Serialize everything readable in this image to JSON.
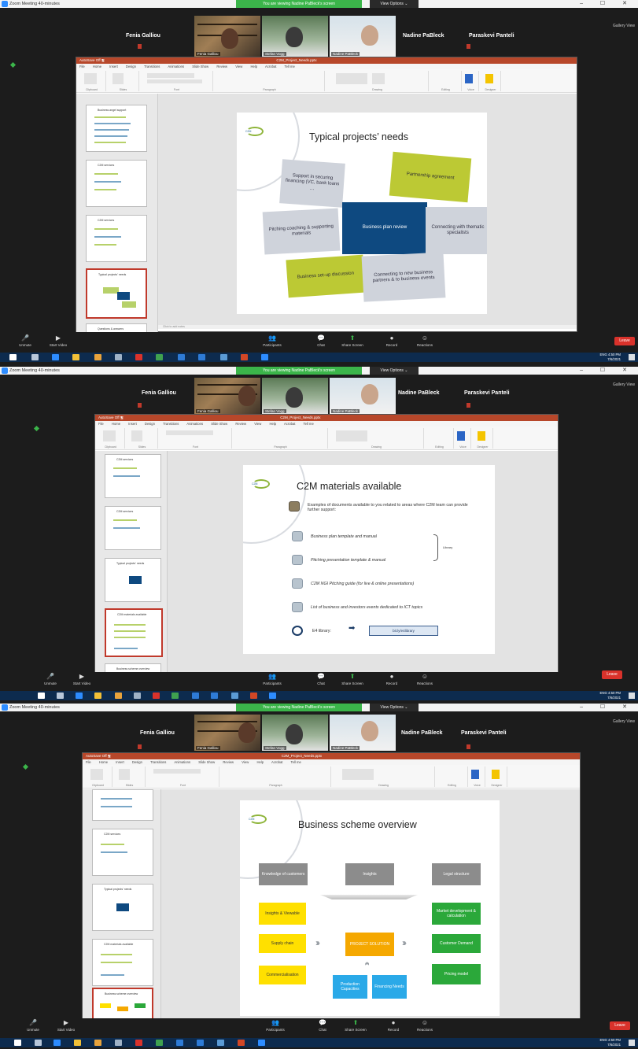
{
  "window": {
    "title": "Zoom Meeting 40-minutes",
    "banner": "You are viewing Nadine PaBleck's screen",
    "view_options": "View Options ⌄",
    "controls": "– ☐ ✕"
  },
  "participants": {
    "left_name": "Fenia Galliou",
    "right_name_1": "Nadine PaBleck",
    "right_name_2": "Paraskevi Panteli",
    "video1_label": "Fenia Galliou",
    "video2_label": "Stefan Vogg",
    "video3_label": "Nadine PaBleck",
    "gallery": "Gallery View"
  },
  "powerpoint": {
    "app": "AutoSave  Off  🖫",
    "doc_title": "C2M_Project_Needs.pptx",
    "tabs": [
      "File",
      "Home",
      "Insert",
      "Design",
      "Transitions",
      "Animations",
      "Slide Show",
      "Review",
      "View",
      "Help",
      "Acrobat",
      "Tell me"
    ],
    "groups": [
      "Clipboard",
      "Slides",
      "Font",
      "Paragraph",
      "Drawing",
      "Editing",
      "Voice",
      "Designer"
    ],
    "status": "Click to add notes"
  },
  "slide1": {
    "title": "Typical projects’ needs",
    "logo": "C2M",
    "boxes": {
      "financing": "Support in securing financing (VC, bank loans …",
      "partnership": "Partnership agreement",
      "pitching": "Pitching coaching & supporting materials",
      "business_plan": "Business plan review",
      "connecting": "Connecting with thematic specialists",
      "setup": "Business set-up discussion",
      "partners": "Connecting to new business partners & to business events"
    },
    "thumb_titles": [
      "Business angel support",
      "C2M services",
      "C2M services",
      "Typical projects' needs",
      "Questions & answers"
    ]
  },
  "slide2": {
    "title": "C2M materials available",
    "logo": "C2M",
    "intro": "Examples of documents available to you related to areas where C2M team can provide further support:",
    "items": [
      "Business plan template and manual",
      "Pitching presentation template & manual",
      "C2M NGI Pitching guide (for live & online presentations)",
      "List of business and investors events dedicated to ICT topics"
    ],
    "brace_label": "Library",
    "library_label": "E4 library:",
    "library_link": "bit.ly/e4library",
    "thumb_titles": [
      "C2M services",
      "C2M services",
      "Typical projects' needs",
      "C2M materials available",
      "Business scheme overview"
    ]
  },
  "slide3": {
    "title": "Business scheme overview",
    "logo": "C2M",
    "top_grey": [
      "Knowledge of customers",
      "Insights",
      "Legal structure"
    ],
    "left_yellow": [
      "Insights & Viewable",
      "Supply chain",
      "Commercialisation"
    ],
    "center": "PROJECT SOLUTION",
    "right_green": [
      "Market development & calculation",
      "Customer Demand",
      "Pricing model"
    ],
    "bottom_blue": [
      "Production Capacities",
      "Financing Needs"
    ],
    "thumb_titles": [
      "C2M services",
      "Typical projects' needs",
      "C2M materials available",
      "Business scheme overview"
    ]
  },
  "toolbar": {
    "unmute": "Unmute",
    "start_video": "Start Video",
    "participants": "Participants",
    "participants_count": "3",
    "chat": "Chat",
    "share": "Share Screen",
    "record": "Record",
    "reactions": "Reactions",
    "leave": "Leave"
  },
  "taskbar": {
    "time": "4:50 PM",
    "date": "7/6/2021",
    "lang": "ENG"
  }
}
